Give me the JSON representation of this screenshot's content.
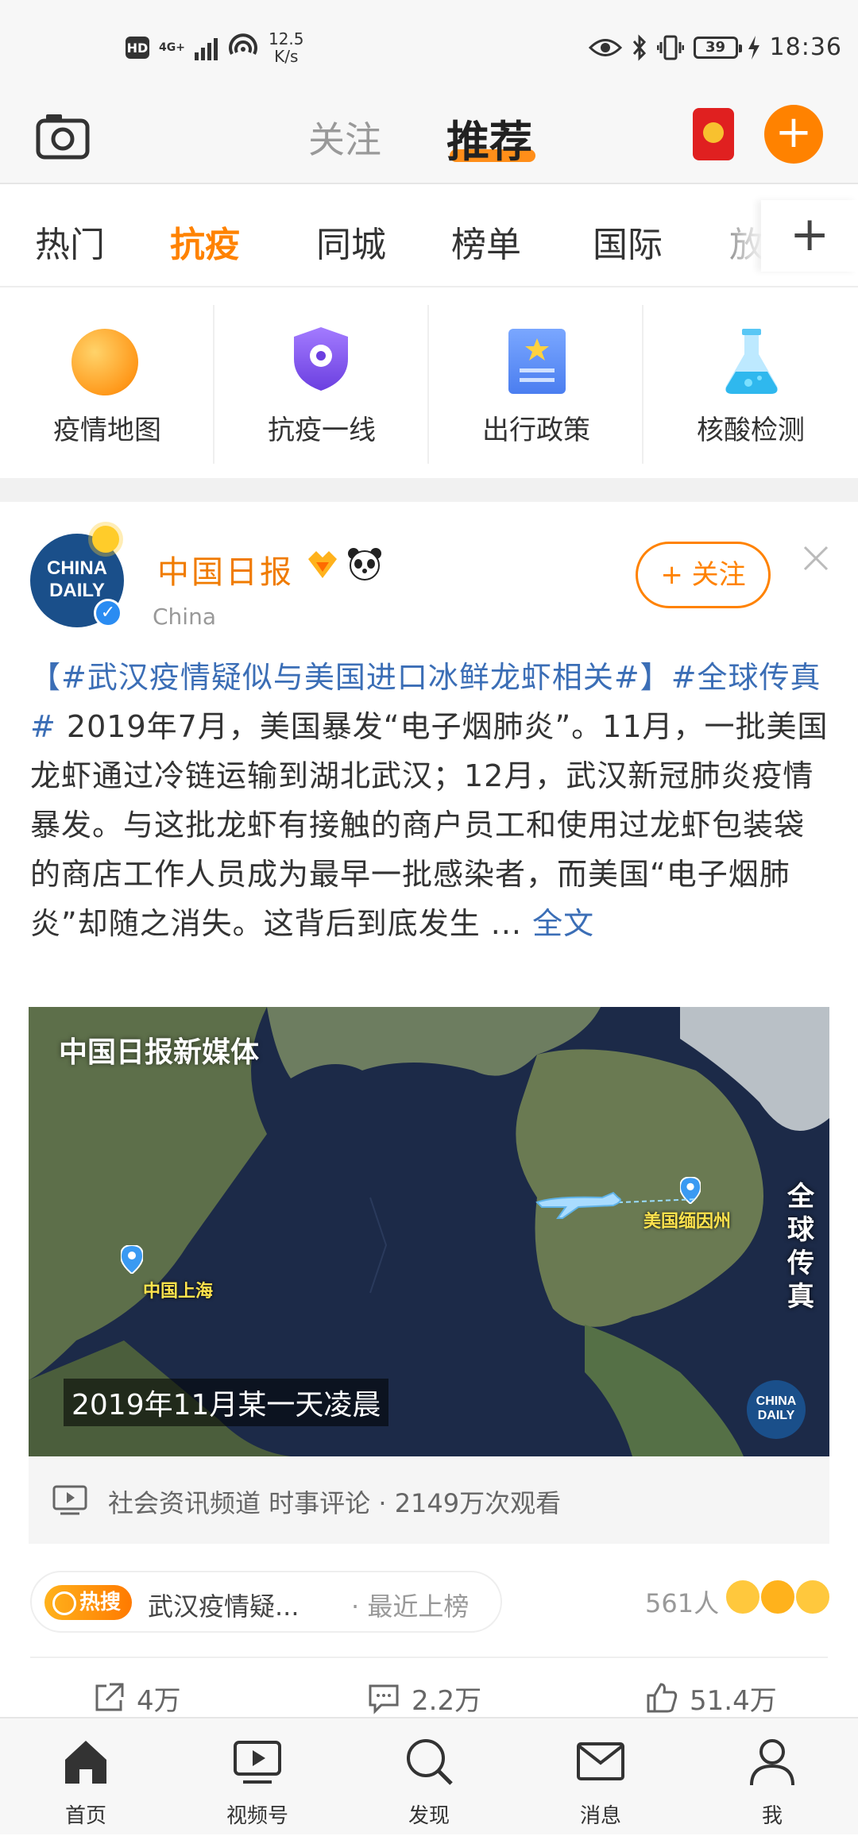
{
  "status_bar": {
    "hd": "HD",
    "network": "4G+",
    "speed": "12.5",
    "speed_unit": "K/s",
    "battery": "39",
    "time": "18:36"
  },
  "header": {
    "tab_follow": "关注",
    "tab_recommend": "推荐",
    "compose": "+"
  },
  "channels": {
    "items": [
      "热门",
      "抗疫",
      "同城",
      "榜单",
      "国际",
      "放"
    ],
    "active_index": 1,
    "add": "+"
  },
  "quick_entries": [
    "疫情地图",
    "抗疫一线",
    "出行政策",
    "核酸检测"
  ],
  "post": {
    "avatar_text_line1": "CHINA",
    "avatar_text_line2": "DAILY",
    "author": "中国日报",
    "source": "China",
    "follow_label": "+ 关注",
    "text_tag1": "【#武汉疫情疑似与美国进口冰鲜龙虾相关#】",
    "text_tag2": "#全球传真#",
    "text_body": " 2019年7月，美国暴发“电子烟肺炎”。11月，一批美国龙虾通过冷链运输到湖北武汉；12月，武汉新冠肺炎疫情暴发。与这批龙虾有接触的商户员工和使用过龙虾包装袋的商店工作人员成为最早一批感染者，而美国“电子烟肺炎”却随之消失。这背后到底发生 ... ",
    "text_more": "全文",
    "video": {
      "watermark": "中国日报新媒体",
      "place_left": "中国上海",
      "place_right": "美国缅因州",
      "side_caption": "全球传真",
      "subtitle": "2019年11月某一天凌晨",
      "brand_line1": "CHINA",
      "brand_line2": "DAILY"
    },
    "video_meta": "社会资讯频道 时事评论  ·  2149万次观看",
    "hot_badge": "热搜",
    "hot_text": "武汉疫情疑...",
    "hot_sub": "·  最近上榜",
    "react_count": "561人",
    "actions": {
      "repost": "4万",
      "comment": "2.2万",
      "like": "51.4万"
    }
  },
  "bottom_nav": [
    "首页",
    "视频号",
    "发现",
    "消息",
    "我"
  ],
  "colors": {
    "accent": "#ff8200",
    "link": "#3b6eb6",
    "author": "#f07b00"
  }
}
